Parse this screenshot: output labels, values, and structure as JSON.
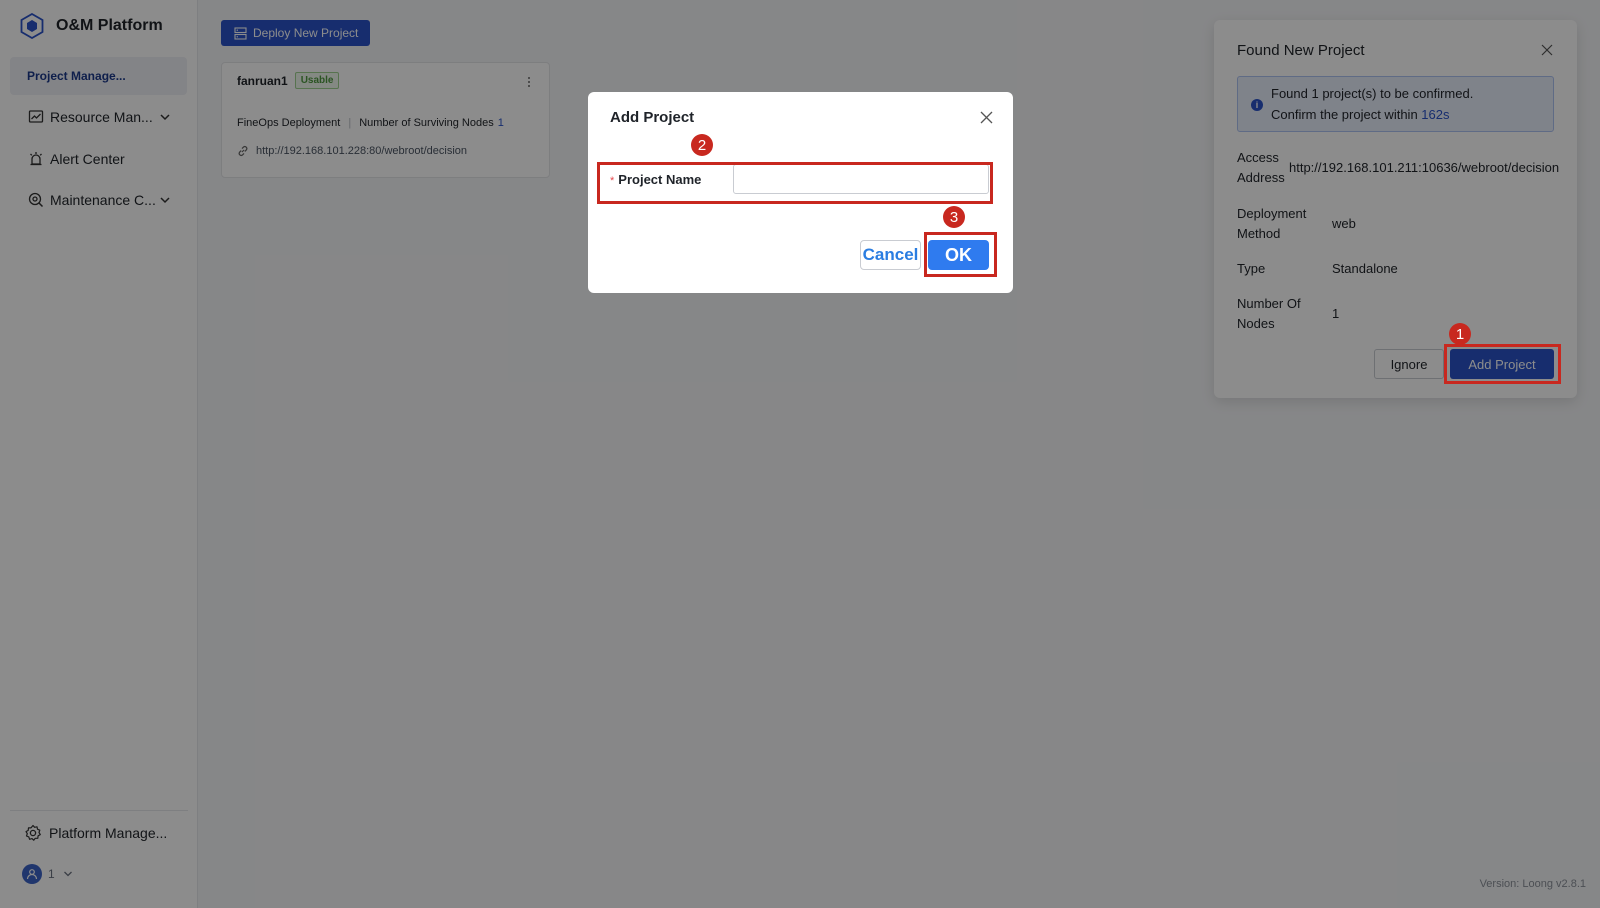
{
  "app": {
    "title": "O&M Platform",
    "logo_icon": "cube-icon"
  },
  "sidebar": {
    "items": [
      {
        "label": "Project Manage...",
        "icon": "",
        "active": true
      },
      {
        "label": "Resource Man...",
        "icon": "chart-icon",
        "has_chevron": true
      },
      {
        "label": "Alert Center",
        "icon": "alarm-icon"
      },
      {
        "label": "Maintenance C...",
        "icon": "maintenance-icon",
        "has_chevron": true
      }
    ],
    "bottom": {
      "label": "Platform Manage...",
      "icon": "gear-icon"
    },
    "user": {
      "name": "1"
    }
  },
  "main": {
    "deploy_button": "Deploy New Project",
    "card": {
      "title": "fanruan1",
      "status": "Usable",
      "deployment": "FineOps Deployment",
      "nodes_label": "Number of Surviving Nodes",
      "nodes_value": "1",
      "url": "http://192.168.101.228:80/webroot/decision"
    },
    "version": "Version: Loong v2.8.1"
  },
  "panel": {
    "title": "Found New Project",
    "alert_line1": "Found 1 project(s) to be confirmed.",
    "alert_line2": "Confirm the project within",
    "alert_seconds": "162s",
    "rows": [
      {
        "label": "Access Address",
        "value": "http://192.168.101.211:10636/webroot/decision"
      },
      {
        "label": "Deployment Method",
        "value": "web"
      },
      {
        "label": "Type",
        "value": "Standalone"
      },
      {
        "label": "Number Of Nodes",
        "value": "1"
      }
    ],
    "ignore_button": "Ignore",
    "add_button": "Add Project"
  },
  "modal": {
    "title": "Add Project",
    "required_mark": "*",
    "field_label": "Project Name",
    "field_value": "",
    "field_placeholder": "",
    "cancel_button": "Cancel",
    "ok_button": "OK"
  },
  "annotations": {
    "step1": "1",
    "step2": "2",
    "step3": "3"
  },
  "colors": {
    "primary": "#2a53c9",
    "ok": "#2f7bef",
    "annotation": "#c8281f",
    "success": "#4f9a40"
  }
}
